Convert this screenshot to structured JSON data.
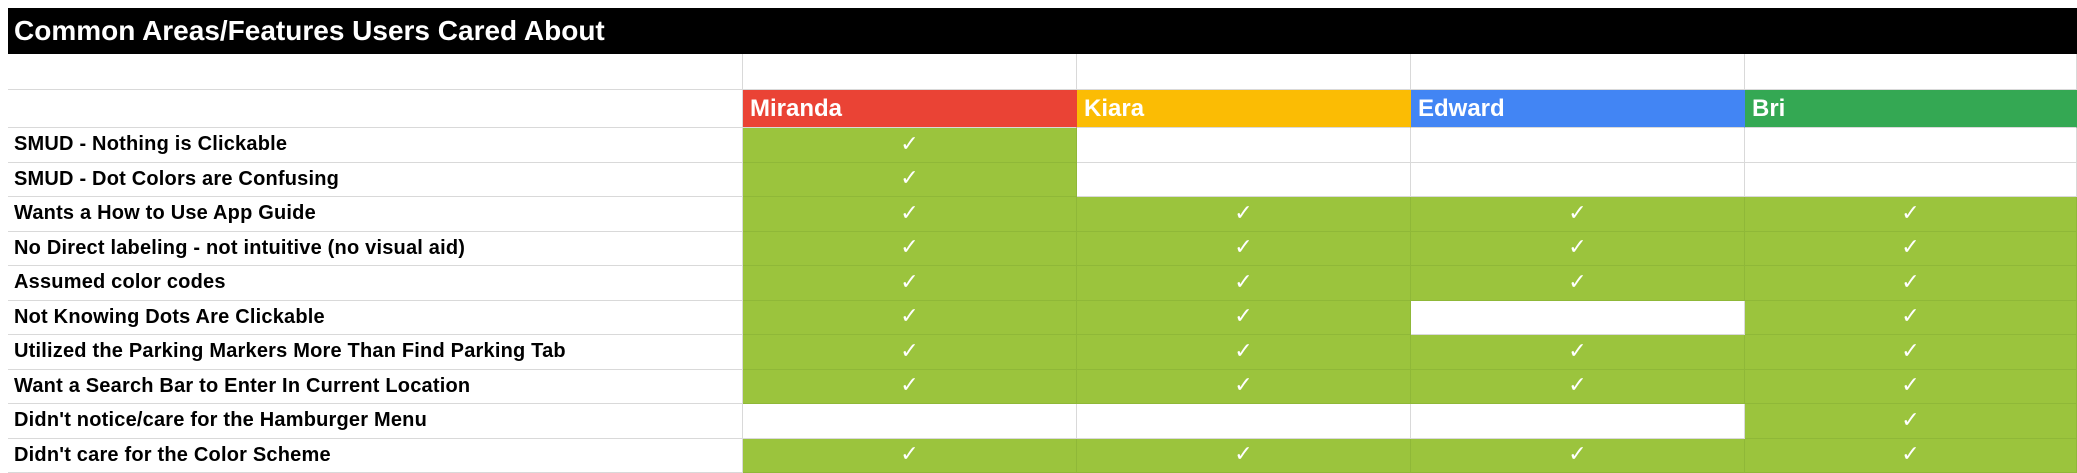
{
  "title": "Common Areas/Features Users Cared About",
  "users": [
    {
      "name": "Miranda",
      "color": "#ea4335"
    },
    {
      "name": "Kiara",
      "color": "#fbbc04"
    },
    {
      "name": "Edward",
      "color": "#4285f4"
    },
    {
      "name": "Bri",
      "color": "#34a853"
    }
  ],
  "check_symbol": "✓",
  "check_color": "#9bc43d",
  "rows": [
    {
      "label": "SMUD - Nothing is Clickable",
      "checks": [
        true,
        false,
        false,
        false
      ]
    },
    {
      "label": "SMUD - Dot Colors are Confusing",
      "checks": [
        true,
        false,
        false,
        false
      ]
    },
    {
      "label": "Wants a How to Use App Guide",
      "checks": [
        true,
        true,
        true,
        true
      ]
    },
    {
      "label": "No Direct labeling - not intuitive (no visual aid)",
      "checks": [
        true,
        true,
        true,
        true
      ]
    },
    {
      "label": "Assumed color codes",
      "checks": [
        true,
        true,
        true,
        true
      ]
    },
    {
      "label": "Not Knowing Dots Are Clickable",
      "checks": [
        true,
        true,
        false,
        true
      ]
    },
    {
      "label": "Utilized the Parking Markers More Than Find Parking Tab",
      "checks": [
        true,
        true,
        true,
        true
      ]
    },
    {
      "label": "Want a Search Bar to Enter In Current Location",
      "checks": [
        true,
        true,
        true,
        true
      ]
    },
    {
      "label": "Didn't notice/care for the Hamburger Menu",
      "checks": [
        false,
        false,
        false,
        true
      ]
    },
    {
      "label": "Didn't care for the Color Scheme",
      "checks": [
        true,
        true,
        true,
        true
      ]
    }
  ]
}
